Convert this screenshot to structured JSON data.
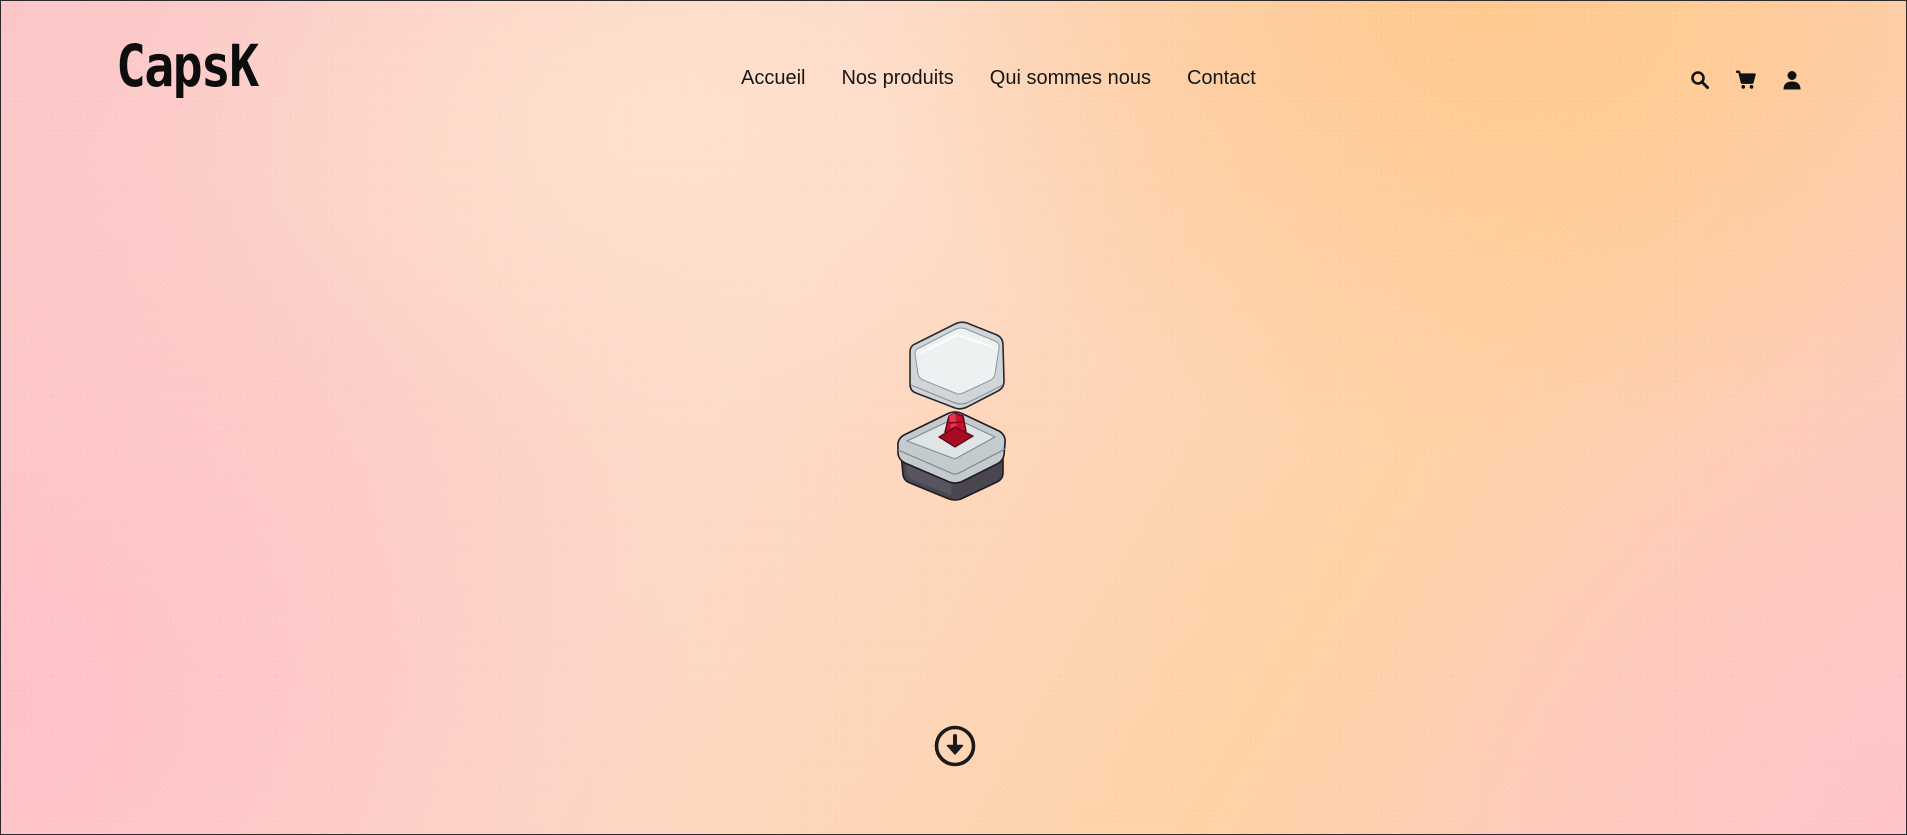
{
  "brand": {
    "logo_text": "CapsK"
  },
  "nav": {
    "items": [
      {
        "label": "Accueil"
      },
      {
        "label": "Nos produits"
      },
      {
        "label": "Qui sommes nous"
      },
      {
        "label": "Contact"
      }
    ]
  },
  "actions": {
    "icons": [
      "search-icon",
      "cart-icon",
      "user-icon"
    ]
  },
  "hero": {
    "illustration": "keyboard-switch-illustration",
    "scroll_icon": "arrow-down-circle-icon"
  },
  "colors": {
    "background_pink": "#fcc6c8",
    "background_peach": "#ffd2a6",
    "text": "#111111",
    "switch_stem": "#c8102e",
    "keycap": "#e3e6e8",
    "switch_housing": "#4a4650"
  }
}
